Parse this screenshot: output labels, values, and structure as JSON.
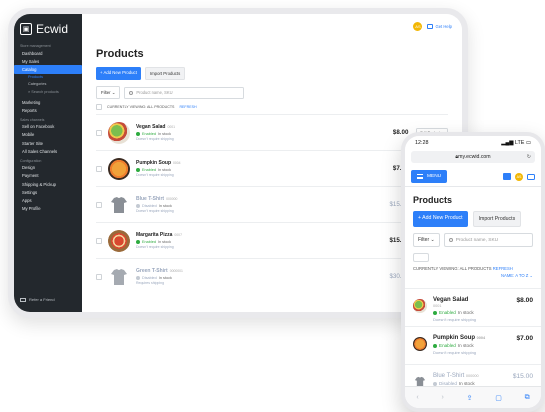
{
  "brand": {
    "logo_text": "Ecwid"
  },
  "sidebar": {
    "sections": [
      {
        "heading": "Store management",
        "items": [
          "Dashboard",
          "My Sales"
        ]
      },
      {
        "heading": "",
        "items": [
          "Catalog"
        ]
      }
    ],
    "catalog_sub": [
      "Products",
      "Categories"
    ],
    "search_placeholder": "Search products",
    "more_items_1": [
      "Marketing",
      "Reports"
    ],
    "sales_channels_heading": "Sales channels",
    "sales_items": [
      "Sell on Facebook",
      "Mobile",
      "Starter Site",
      "All Sales Channels"
    ],
    "config_heading": "Configuration",
    "config_items": [
      "Design",
      "Payment",
      "Shipping & Pickup",
      "Settings",
      "Apps",
      "My Profile"
    ],
    "refer_label": "Refer a Friend"
  },
  "header": {
    "avatar_initials": "AS",
    "help_label": "Get Help"
  },
  "main": {
    "title": "Products",
    "add_button": "+ Add New Product",
    "import_button": "Import Products",
    "filter_label": "Filter",
    "search_placeholder": "Product name, SKU",
    "viewing_text": "CURRENTLY VIEWING: ALL PRODUCTS",
    "refresh_label": "REFRESH",
    "products": [
      {
        "name": "Vegan Salad",
        "sku": "0001",
        "status": "Enabled",
        "stock": "In stock",
        "shipping": "Doesn't require shipping",
        "price": "$8.00",
        "edit": "Edit Product"
      },
      {
        "name": "Pumpkin Soup",
        "sku": "0004",
        "status": "Enabled",
        "stock": "In stock",
        "shipping": "Doesn't require shipping",
        "price": "$7.00",
        "edit": "Edit Product"
      },
      {
        "name": "Blue T-Shirt",
        "sku": "000000",
        "status": "Disabled",
        "stock": "In stock",
        "shipping": "Doesn't require shipping",
        "price": "$15.00",
        "edit": "Edit Product"
      },
      {
        "name": "Margarita Pizza",
        "sku": "0007",
        "status": "Enabled",
        "stock": "In stock",
        "shipping": "Doesn't require shipping",
        "price": "$15.00",
        "edit": "Edit Product"
      },
      {
        "name": "Green T-Shirt",
        "sku": "0000001",
        "status": "Disabled",
        "stock": "In stock",
        "shipping": "Requires shipping",
        "price": "$30.00",
        "edit": "Edit Product"
      }
    ]
  },
  "phone": {
    "time": "12:28",
    "signal": "LTE",
    "url": "my.ecwid.com",
    "menu_label": "MENU",
    "avatar_initials": "AS",
    "title": "Products",
    "add_button": "+ Add New Product",
    "import_button": "Import Products",
    "filter_label": "Filter",
    "search_placeholder": "Product name, SKU",
    "viewing_text": "CURRENTLY VIEWING: ALL PRODUCTS",
    "refresh_label": "REFRESH",
    "sort_label": "NAME: A TO Z",
    "products": [
      {
        "name": "Vegan Salad",
        "sku": "0001",
        "status": "Enabled",
        "stock": "In stock",
        "shipping": "Doesn't require shipping",
        "price": "$8.00"
      },
      {
        "name": "Pumpkin Soup",
        "sku": "0004",
        "status": "Enabled",
        "stock": "In stock",
        "shipping": "Doesn't require shipping",
        "price": "$7.00"
      },
      {
        "name": "Blue T-Shirt",
        "sku": "000000",
        "status": "Disabled",
        "stock": "In stock",
        "shipping": "",
        "price": "$15.00"
      }
    ]
  },
  "colors": {
    "accent": "#2d7ff9",
    "sidebar_bg": "#23282d",
    "enabled": "#2dab3f",
    "disabled": "#9aa7bd",
    "avatar": "#f2b705"
  }
}
